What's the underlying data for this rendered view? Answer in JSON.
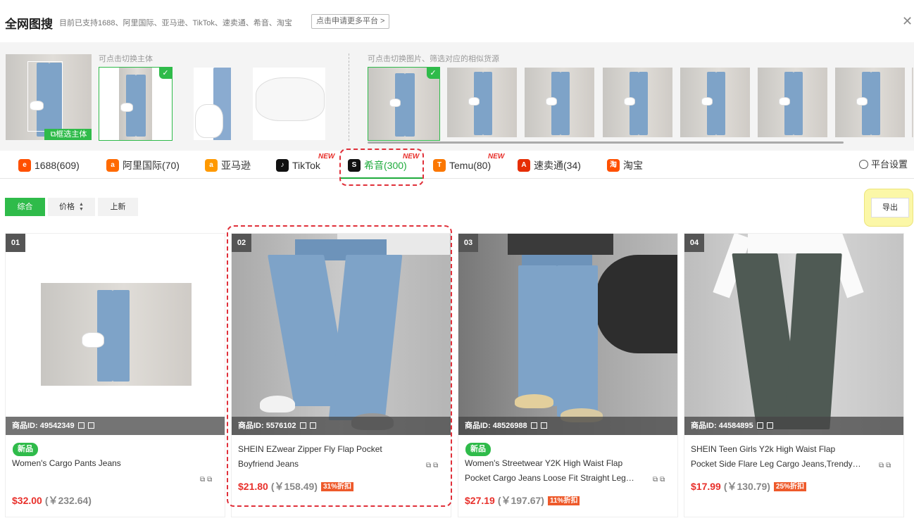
{
  "header": {
    "title": "全网图搜",
    "subtitle": "目前已支持1688、阿里国际、亚马逊、TikTok、速卖通、希音、淘宝",
    "apply_label": "点击申请更多平台 >",
    "close_icon": "close-icon"
  },
  "strip": {
    "subject_hint": "可点击切换主体",
    "similar_hint": "可点击切换图片、筛选对应的相似货源",
    "frame_button": "框选主体"
  },
  "tabs": [
    {
      "label": "1688(609)",
      "icon": "1688-icon",
      "color": "#ff5000",
      "new": ""
    },
    {
      "label": "阿里国际(70)",
      "icon": "alibaba-icon",
      "color": "#ff6a00",
      "new": ""
    },
    {
      "label": "亚马逊",
      "icon": "amazon-icon",
      "color": "#ff9900",
      "new": ""
    },
    {
      "label": "TikTok",
      "icon": "tiktok-icon",
      "color": "#111111",
      "new": "NEW"
    },
    {
      "label": "希音(300)",
      "icon": "shein-icon",
      "color": "#111111",
      "new": "NEW"
    },
    {
      "label": "Temu(80)",
      "icon": "temu-icon",
      "color": "#fb7701",
      "new": "NEW"
    },
    {
      "label": "速卖通(34)",
      "icon": "aliexpress-icon",
      "color": "#e62e04",
      "new": ""
    },
    {
      "label": "淘宝",
      "icon": "taobao-icon",
      "color": "#ff5000",
      "new": ""
    }
  ],
  "settings_label": "平台设置",
  "sort": {
    "all": "综合",
    "price": "价格",
    "new": "上新"
  },
  "export_label": "导出",
  "products": [
    {
      "rank": "01",
      "id": "商品ID: 49542349",
      "badge": "新品",
      "title_lines": [
        "Women's Cargo Pants Jeans"
      ],
      "price": "$32.00",
      "cny": "(￥232.64)",
      "discount": ""
    },
    {
      "rank": "02",
      "id": "商品ID: 5576102",
      "badge": "",
      "title_lines": [
        "SHEIN EZwear Zipper Fly Flap Pocket",
        "Boyfriend Jeans"
      ],
      "price": "$21.80",
      "cny": "(￥158.49)",
      "discount": "31%折扣"
    },
    {
      "rank": "03",
      "id": "商品ID: 48526988",
      "badge": "新品",
      "title_lines": [
        "Women's Streetwear Y2K High Waist Flap",
        "Pocket Cargo Jeans Loose Fit Straight Leg…"
      ],
      "price": "$27.19",
      "cny": "(￥197.67)",
      "discount": "11%折扣"
    },
    {
      "rank": "04",
      "id": "商品ID: 44584895",
      "badge": "",
      "title_lines": [
        "SHEIN Teen Girls Y2k High Waist Flap",
        "Pocket Side Flare Leg Cargo Jeans,Trendy…"
      ],
      "price": "$17.99",
      "cny": "(￥130.79)",
      "discount": "25%折扣"
    }
  ]
}
